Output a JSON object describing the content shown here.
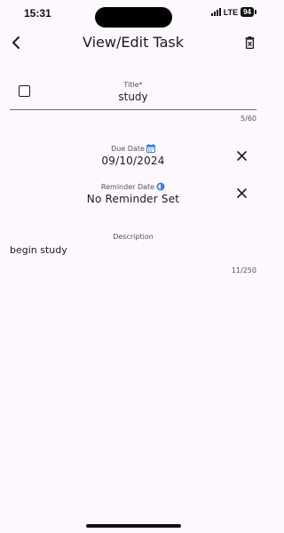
{
  "status_bar": {
    "time": "15:31",
    "network": "LTE",
    "battery": "94"
  },
  "header": {
    "title": "View/Edit Task",
    "back_icon": "chevron-left-icon",
    "delete_icon": "delete-icon"
  },
  "title_field": {
    "label": "Title*",
    "value": "study",
    "counter": "5/60",
    "completed": false
  },
  "due_date": {
    "label": "Due Date",
    "icon": "calendar-icon",
    "value": "09/10/2024"
  },
  "reminder_date": {
    "label": "Reminder Date",
    "icon": "clock-icon",
    "value": "No Reminder Set"
  },
  "description_field": {
    "label": "Description",
    "value": "begin study",
    "counter": "11/250"
  },
  "colors": {
    "background": "#fcf8fd",
    "text": "#1c1b1f",
    "accent": "#3d7bd9"
  }
}
